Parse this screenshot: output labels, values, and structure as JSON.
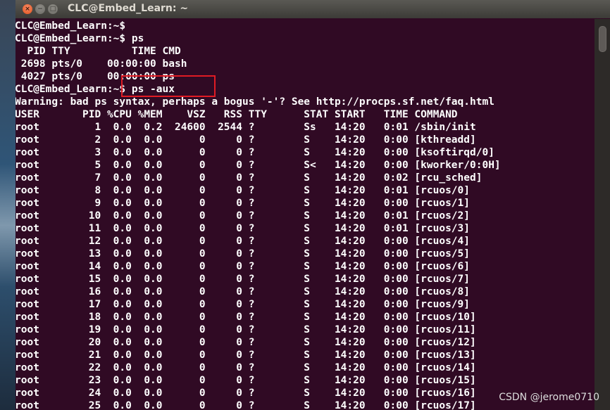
{
  "window": {
    "title": "CLC@Embed_Learn: ~",
    "close_symbol": "×",
    "minimize_symbol": "−",
    "maximize_symbol": "□"
  },
  "terminal": {
    "lines": [
      "CLC@Embed_Learn:~$",
      "CLC@Embed_Learn:~$ ps",
      "  PID TTY          TIME CMD",
      " 2698 pts/0    00:00:00 bash",
      " 4027 pts/0    00:00:00 ps",
      "CLC@Embed_Learn:~$ ps -aux",
      "Warning: bad ps syntax, perhaps a bogus '-'? See http://procps.sf.net/faq.html",
      "USER       PID %CPU %MEM    VSZ   RSS TTY      STAT START   TIME COMMAND",
      "root         1  0.0  0.2  24600  2544 ?        Ss   14:20   0:01 /sbin/init",
      "root         2  0.0  0.0      0     0 ?        S    14:20   0:00 [kthreadd]",
      "root         3  0.0  0.0      0     0 ?        S    14:20   0:00 [ksoftirqd/0]",
      "root         5  0.0  0.0      0     0 ?        S<   14:20   0:00 [kworker/0:0H]",
      "root         7  0.0  0.0      0     0 ?        S    14:20   0:02 [rcu_sched]",
      "root         8  0.0  0.0      0     0 ?        S    14:20   0:01 [rcuos/0]",
      "root         9  0.0  0.0      0     0 ?        S    14:20   0:00 [rcuos/1]",
      "root        10  0.0  0.0      0     0 ?        S    14:20   0:01 [rcuos/2]",
      "root        11  0.0  0.0      0     0 ?        S    14:20   0:01 [rcuos/3]",
      "root        12  0.0  0.0      0     0 ?        S    14:20   0:00 [rcuos/4]",
      "root        13  0.0  0.0      0     0 ?        S    14:20   0:00 [rcuos/5]",
      "root        14  0.0  0.0      0     0 ?        S    14:20   0:00 [rcuos/6]",
      "root        15  0.0  0.0      0     0 ?        S    14:20   0:00 [rcuos/7]",
      "root        16  0.0  0.0      0     0 ?        S    14:20   0:00 [rcuos/8]",
      "root        17  0.0  0.0      0     0 ?        S    14:20   0:00 [rcuos/9]",
      "root        18  0.0  0.0      0     0 ?        S    14:20   0:00 [rcuos/10]",
      "root        19  0.0  0.0      0     0 ?        S    14:20   0:00 [rcuos/11]",
      "root        20  0.0  0.0      0     0 ?        S    14:20   0:00 [rcuos/12]",
      "root        21  0.0  0.0      0     0 ?        S    14:20   0:00 [rcuos/13]",
      "root        22  0.0  0.0      0     0 ?        S    14:20   0:00 [rcuos/14]",
      "root        23  0.0  0.0      0     0 ?        S    14:20   0:00 [rcuos/15]",
      "root        24  0.0  0.0      0     0 ?        S    14:20   0:00 [rcuos/16]",
      "root        25  0.0  0.0      0     0 ?        S    14:20   0:00 [rcuos/17]"
    ]
  },
  "watermark": "CSDN @jerome0710",
  "colors": {
    "terminal_bg": "#300a24",
    "terminal_fg": "#ffffff",
    "highlight_border": "#e01b24",
    "titlebar": "#3c3b37"
  }
}
